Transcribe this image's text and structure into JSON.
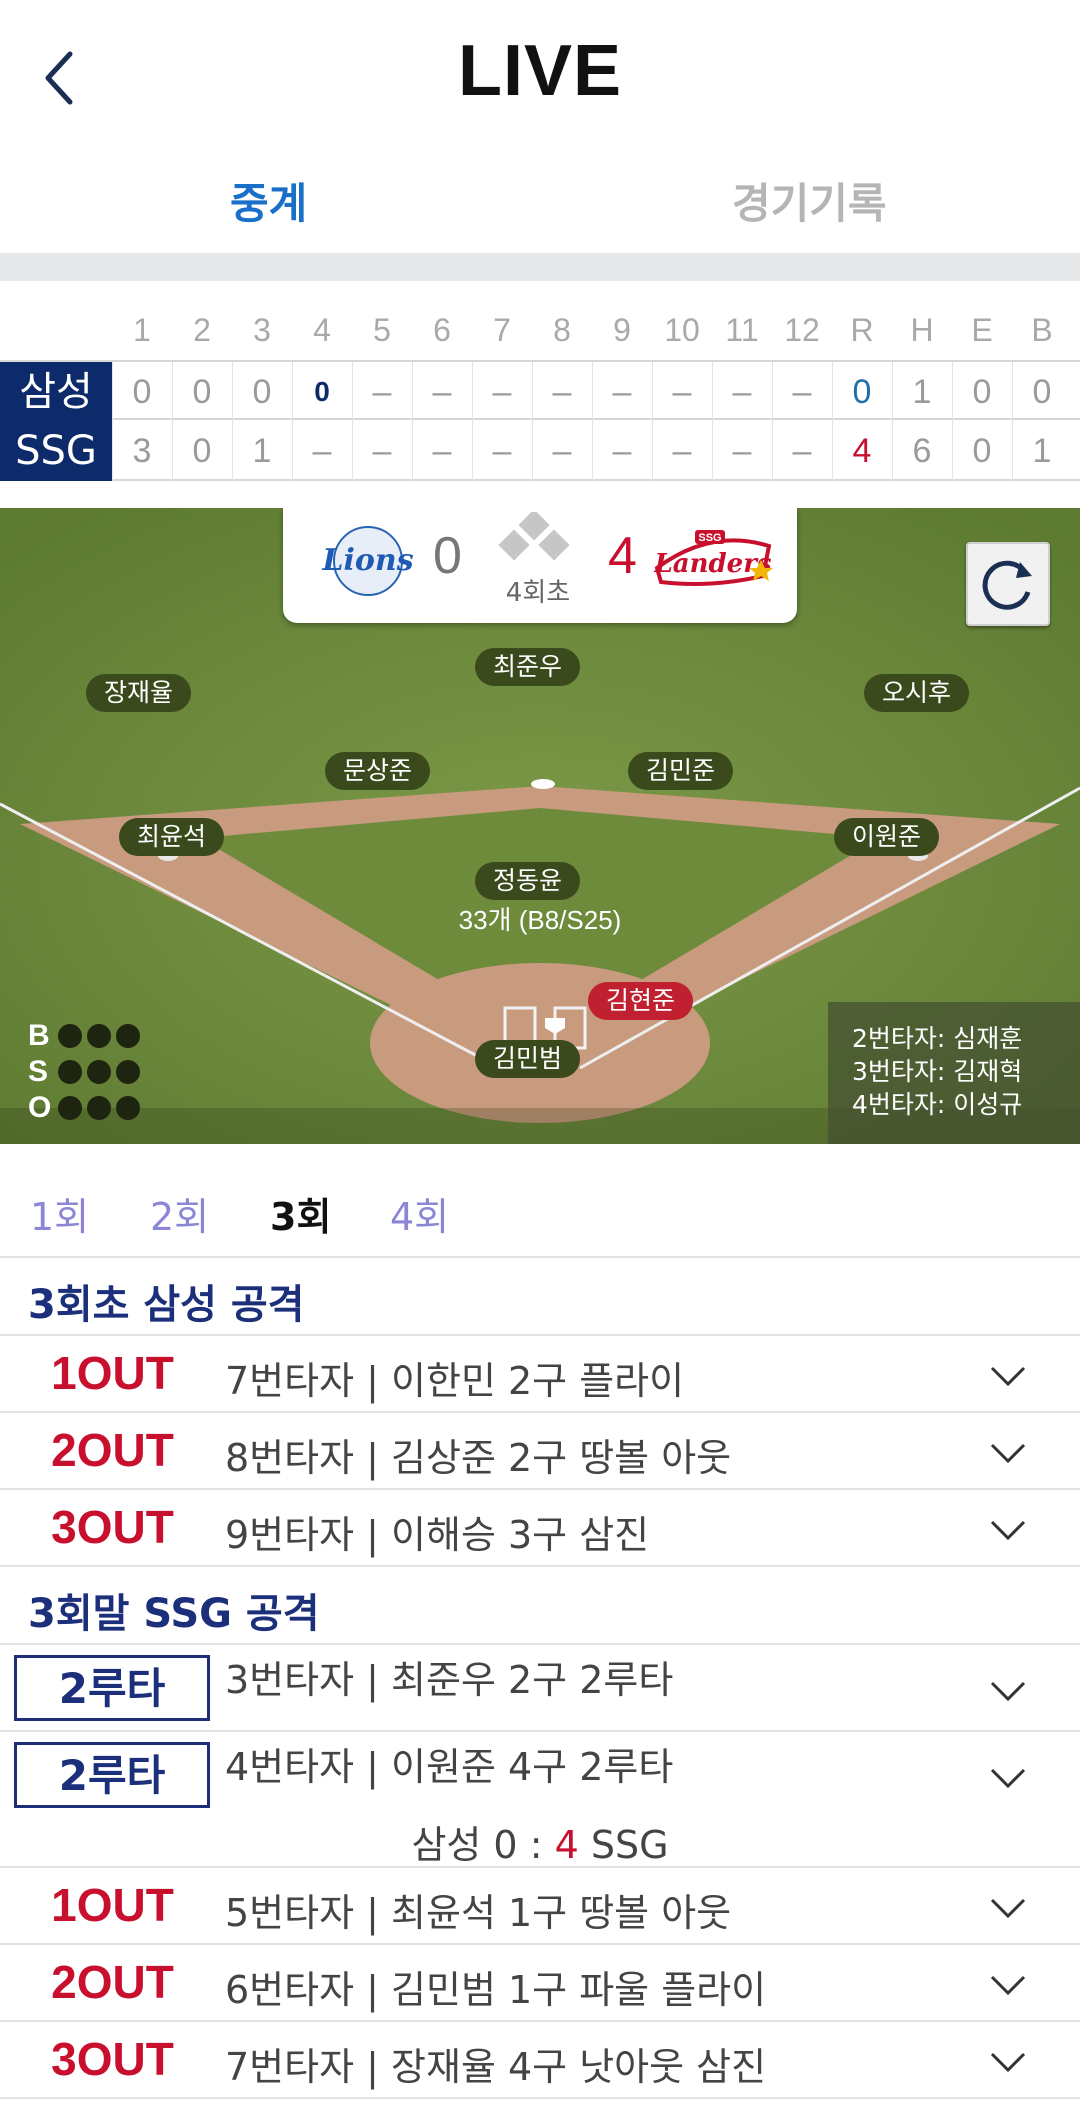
{
  "header": {
    "title": "LIVE"
  },
  "tabs": {
    "broadcast": "중계",
    "record": "경기기록"
  },
  "scoreboard": {
    "columns": [
      "1",
      "2",
      "3",
      "4",
      "5",
      "6",
      "7",
      "8",
      "9",
      "10",
      "11",
      "12",
      "R",
      "H",
      "E",
      "B"
    ],
    "away": {
      "team": "삼성",
      "cells": [
        "0",
        "0",
        "0",
        "0",
        "–",
        "–",
        "–",
        "–",
        "–",
        "–",
        "–",
        "–",
        "0",
        "1",
        "0",
        "0"
      ]
    },
    "home": {
      "team": "SSG",
      "cells": [
        "3",
        "0",
        "1",
        "–",
        "–",
        "–",
        "–",
        "–",
        "–",
        "–",
        "–",
        "–",
        "4",
        "6",
        "0",
        "1"
      ]
    }
  },
  "game": {
    "away_score": "0",
    "home_score": "4",
    "inning": "4회초",
    "away_logo_text": "Lions",
    "home_logo_text": "Landers",
    "home_logo_badge": "SSG"
  },
  "field": {
    "fielders": {
      "lf": "장재율",
      "cf": "최준우",
      "rf": "오시후",
      "ss": "문상준",
      "b2": "김민준",
      "b3": "최윤석",
      "b1": "이원준",
      "pitcher": "정동윤",
      "catcher": "김민범",
      "batter": "김현준"
    },
    "pitch_count": "33개 (B8/S25)",
    "bso_labels": [
      "B",
      "S",
      "O"
    ],
    "next_batters": [
      "2번타자: 심재훈",
      "3번타자: 김재혁",
      "4번타자: 이성규"
    ]
  },
  "inning_tabs": [
    "1회",
    "2회",
    "3회",
    "4회"
  ],
  "active_inning": "3회",
  "plays": {
    "top_header": "3회초 삼성 공격",
    "top": [
      {
        "result": "1OUT",
        "text": "7번타자 | 이한민 2구 플라이"
      },
      {
        "result": "2OUT",
        "text": "8번타자 | 김상준 2구 땅볼 아웃"
      },
      {
        "result": "3OUT",
        "text": "9번타자 | 이해승 3구 삼진"
      }
    ],
    "bottom_header": "3회말 SSG 공격",
    "bottom": [
      {
        "result": "2루타",
        "text": "3번타자 | 최준우 2구 2루타"
      },
      {
        "result": "2루타",
        "text": "4번타자 | 이원준 4구 2루타"
      },
      {
        "result": "1OUT",
        "text": "5번타자 | 최윤석 1구 땅볼 아웃"
      },
      {
        "result": "2OUT",
        "text": "6번타자 | 김민범 1구 파울 플라이"
      },
      {
        "result": "3OUT",
        "text": "7번타자 | 장재율 4구 낫아웃 삼진"
      }
    ],
    "score_update": {
      "away": "삼성 0",
      "sep": " : ",
      "home_score": "4",
      "home": " SSG"
    }
  },
  "colors": {
    "accent": "#1a6fc9",
    "navy": "#0d2b6b",
    "red": "#c8102e",
    "inning_tab": "#8b86d6"
  }
}
